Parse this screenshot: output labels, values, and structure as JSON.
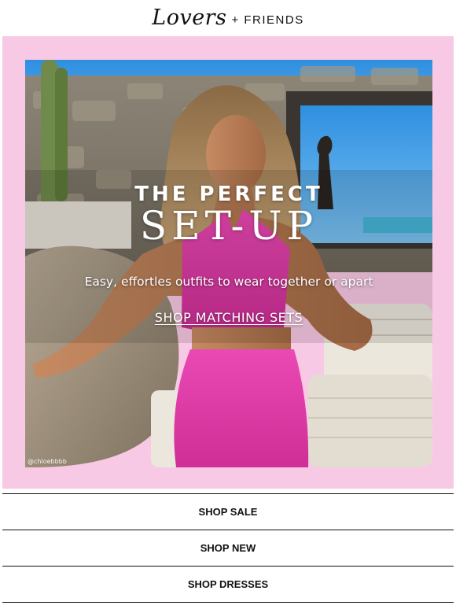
{
  "header": {
    "logo_script": "Lovers",
    "logo_rest": "+ FRIENDS"
  },
  "hero": {
    "kicker": "THE PERFECT",
    "headline": "SET-UP",
    "subtitle": "Easy, effortles outfits to wear together or apart",
    "cta_label": "SHOP MATCHING SETS",
    "photo_credit": "@chloebbbb",
    "frame_color": "#f8c9e4",
    "outfit_color": "#e23aa8"
  },
  "nav": {
    "items": [
      {
        "label": "SHOP SALE"
      },
      {
        "label": "SHOP NEW"
      },
      {
        "label": "SHOP DRESSES"
      }
    ]
  }
}
